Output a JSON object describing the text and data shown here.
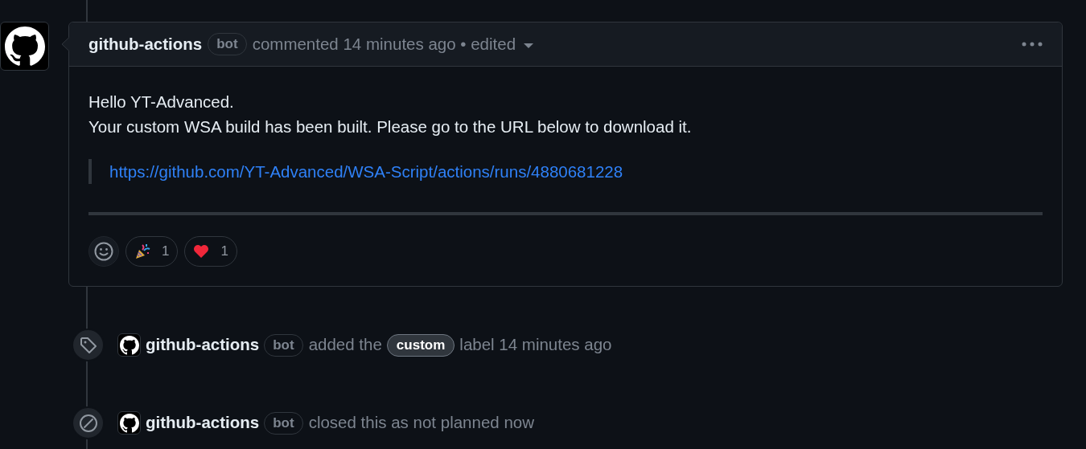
{
  "comment": {
    "author": "github-actions",
    "badge": "bot",
    "meta": "commented 14 minutes ago • edited",
    "body": {
      "lines": [
        "Hello YT-Advanced.",
        "Your custom WSA build has been built. Please go to the URL below to download it."
      ],
      "quote_link": "https://github.com/YT-Advanced/WSA-Script/actions/runs/4880681228"
    },
    "reactions": [
      {
        "kind": "tada",
        "count": "1"
      },
      {
        "kind": "heart",
        "count": "1"
      }
    ]
  },
  "events": [
    {
      "kind": "labeled",
      "author": "github-actions",
      "badge": "bot",
      "before": "added the",
      "label": "custom",
      "after": "label 14 minutes ago"
    },
    {
      "kind": "closed",
      "author": "github-actions",
      "badge": "bot",
      "before": "closed this as not planned now"
    }
  ]
}
